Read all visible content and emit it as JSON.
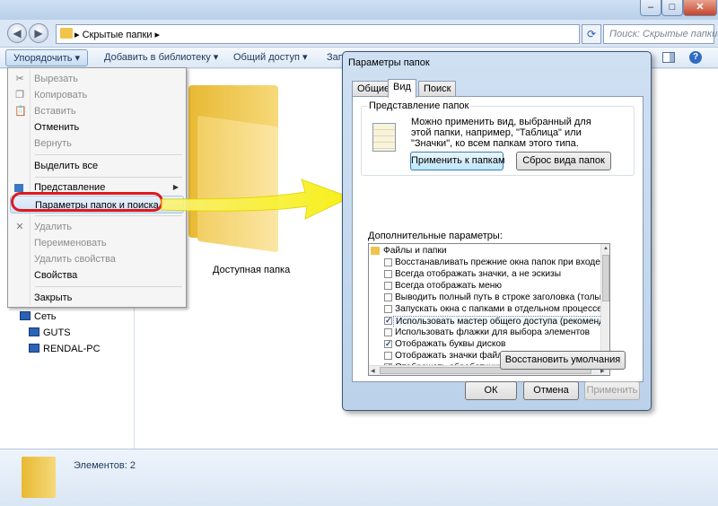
{
  "explorer": {
    "address_crumb": "Скрытые папки",
    "search_placeholder": "Поиск: Скрытые папки",
    "window_controls": {
      "minimize": "–",
      "maximize": "□",
      "close": "✕"
    },
    "toolbar": {
      "organize": "Упорядочить ▾",
      "add_library": "Добавить в библиотеку ▾",
      "share": "Общий доступ ▾",
      "burn": "Запи"
    },
    "folder_label": "Доступная папка",
    "network": {
      "title": "Сеть",
      "items": [
        "GUTS",
        "RENDAL-PC"
      ]
    },
    "status_count": "Элементов: 2"
  },
  "menu": {
    "items": [
      {
        "label": "Вырезать",
        "disabled": true,
        "icon": "scissors-icon"
      },
      {
        "label": "Копировать",
        "disabled": true,
        "icon": "copy-icon"
      },
      {
        "label": "Вставить",
        "disabled": true,
        "icon": "paste-icon"
      },
      {
        "label": "Отменить",
        "disabled": false
      },
      {
        "label": "Вернуть",
        "disabled": true
      },
      {
        "label": "Выделить все",
        "disabled": false
      },
      {
        "label": "Представление",
        "disabled": false,
        "submenu": true
      },
      {
        "label": "Параметры папок и поиска",
        "disabled": false,
        "highlighted": true
      },
      {
        "label": "Удалить",
        "disabled": true,
        "icon": "delete-icon"
      },
      {
        "label": "Переименовать",
        "disabled": true
      },
      {
        "label": "Удалить свойства",
        "disabled": true
      },
      {
        "label": "Свойства",
        "disabled": false
      },
      {
        "label": "Закрыть",
        "disabled": false
      }
    ]
  },
  "dialog": {
    "title": "Параметры папок",
    "tabs": [
      "Общие",
      "Вид",
      "Поиск"
    ],
    "active_tab": "Вид",
    "view_group": {
      "label": "Представление папок",
      "text": "Можно применить вид, выбранный для этой папки, например, \"Таблица\" или \"Значки\", ко всем папкам этого типа.",
      "apply_button": "Применить к папкам",
      "reset_button": "Сброс вида папок"
    },
    "advanced": {
      "label": "Дополнительные параметры:",
      "root": "Файлы и папки",
      "options": [
        {
          "text": "Восстанавливать прежние окна папок при входе в си",
          "checked": false
        },
        {
          "text": "Всегда отображать значки, а не эскизы",
          "checked": false
        },
        {
          "text": "Всегда отображать меню",
          "checked": false
        },
        {
          "text": "Выводить полный путь в строке заголовка (только д",
          "checked": false
        },
        {
          "text": "Запускать окна с папками в отдельном процессе",
          "checked": false
        },
        {
          "text": "Использовать мастер общего доступа (рекомендуется)",
          "checked": true,
          "highlighted": true
        },
        {
          "text": "Использовать флажки для выбора элементов",
          "checked": false
        },
        {
          "text": "Отображать буквы дисков",
          "checked": true
        },
        {
          "text": "Отображать значки файлов на эскизах",
          "checked": false
        },
        {
          "text": "Отображать обработчики просмотра в панели просм",
          "checked": true
        }
      ]
    },
    "restore_button": "Восстановить умолчания",
    "ok_button": "ОК",
    "cancel_button": "Отмена",
    "apply_button": "Применить"
  },
  "colors": {
    "callout": "#e0181b",
    "arrow": "#f7ee00"
  }
}
